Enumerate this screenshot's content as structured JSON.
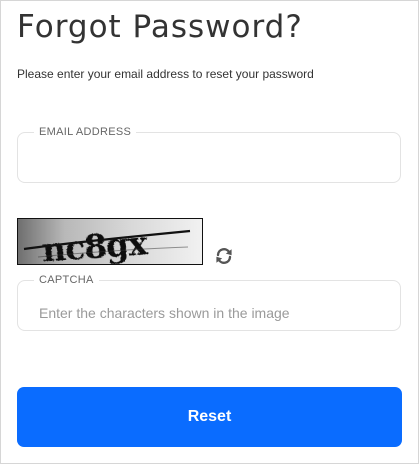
{
  "header": {
    "title": "Forgot Password?",
    "subtitle": "Please enter your email address to reset your password"
  },
  "email_field": {
    "label": "EMAIL ADDRESS",
    "value": "",
    "placeholder": ""
  },
  "captcha": {
    "image_text": "nc8gx",
    "refresh_icon": "refresh-icon",
    "label": "CAPTCHA",
    "value": "",
    "placeholder": "Enter the characters shown in the image"
  },
  "actions": {
    "reset_label": "Reset"
  },
  "colors": {
    "primary": "#0a6cff",
    "text": "#333333",
    "border": "#e3e3e3"
  }
}
